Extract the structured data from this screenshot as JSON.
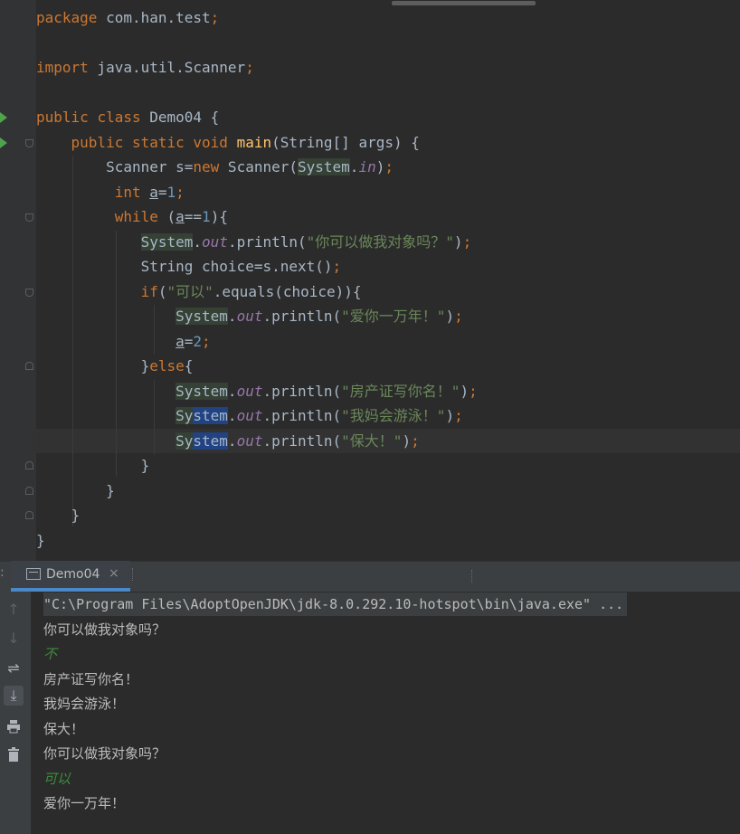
{
  "editor": {
    "lines": [
      {
        "t": "package com.han.test;"
      },
      {
        "t": ""
      },
      {
        "t": "import java.util.Scanner;"
      },
      {
        "t": ""
      },
      {
        "t": "public class Demo04 {"
      },
      {
        "t": "    public static void main(String[] args) {"
      },
      {
        "t": "        Scanner s=new Scanner(System.in);"
      },
      {
        "t": "         int a=1;"
      },
      {
        "t": "         while (a==1){"
      },
      {
        "t": "            System.out.println(\"你可以做我对象吗？\");"
      },
      {
        "t": "            String choice=s.next();"
      },
      {
        "t": "            if(\"可以\".equals(choice)){"
      },
      {
        "t": "                System.out.println(\"爱你一万年！\");"
      },
      {
        "t": "                a=2;"
      },
      {
        "t": "            }else{"
      },
      {
        "t": "                System.out.println(\"房产证写你名！\");"
      },
      {
        "t": "                System.out.println(\"我妈会游泳！\");"
      },
      {
        "t": "                System.out.println(\"保大！\");"
      },
      {
        "t": "            }"
      },
      {
        "t": "        }"
      },
      {
        "t": "    }"
      },
      {
        "t": "}"
      }
    ]
  },
  "run_panel": {
    "tab_colon": ":",
    "tab_label": "Demo04",
    "tab_close": "×",
    "toolbar_icons": [
      "up-arrow-icon",
      "down-arrow-icon",
      "soft-wrap-icon",
      "scroll-to-end-icon",
      "print-icon",
      "trash-icon"
    ],
    "console_lines": [
      {
        "text": "\"C:\\Program Files\\AdoptOpenJDK\\jdk-8.0.292.10-hotspot\\bin\\java.exe\" ...",
        "kind": "cmd"
      },
      {
        "text": "你可以做我对象吗？",
        "kind": "out"
      },
      {
        "text": "不",
        "kind": "input"
      },
      {
        "text": "房产证写你名！",
        "kind": "out"
      },
      {
        "text": "我妈会游泳！",
        "kind": "out"
      },
      {
        "text": "保大！",
        "kind": "out"
      },
      {
        "text": "你可以做我对象吗？",
        "kind": "out"
      },
      {
        "text": "可以",
        "kind": "input"
      },
      {
        "text": "爱你一万年！",
        "kind": "out"
      }
    ]
  },
  "colors": {
    "keyword": "#cc7832",
    "function": "#ffc66d",
    "string": "#6a8759",
    "number": "#6897bb",
    "field": "#9876aa",
    "run_arrow": "#4fa34f",
    "input_text": "#3c8f3c"
  }
}
